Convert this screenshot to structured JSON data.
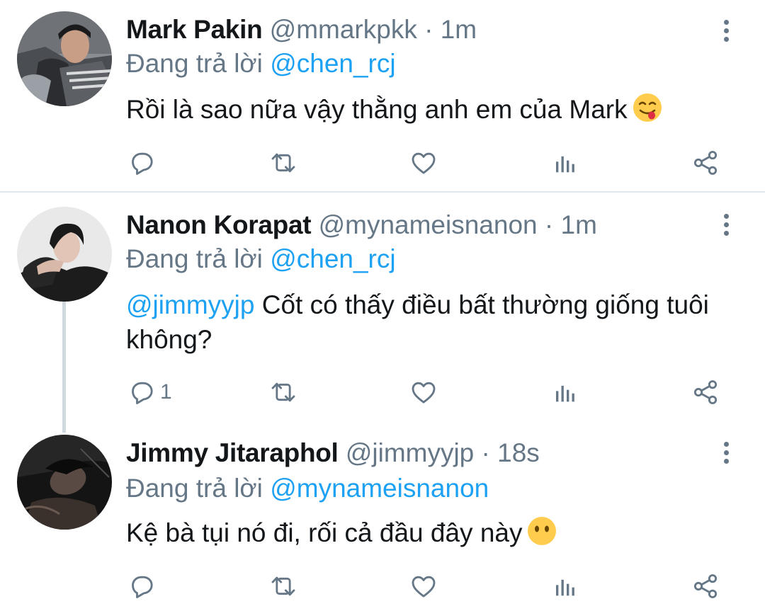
{
  "tweets": [
    {
      "name": "Mark Pakin",
      "handle": "@mmarkpkk",
      "separator": "·",
      "time": "1m",
      "reply_label": "Đang trả lời",
      "reply_to": "@chen_rcj",
      "mention": "",
      "text": "Rồi là sao nữa vậy thằng anh em của Mark",
      "emoji": "face-savoring-food-emoji",
      "reply_count": "",
      "icons": {
        "reply": "reply-icon",
        "retweet": "retweet-icon",
        "like": "heart-icon",
        "analytics": "analytics-icon",
        "share": "share-icon",
        "more": "more-vertical-icon"
      }
    },
    {
      "name": "Nanon Korapat",
      "handle": "@mynameisnanon",
      "separator": "·",
      "time": "1m",
      "reply_label": "Đang trả lời",
      "reply_to": "@chen_rcj",
      "mention": "@jimmyyjp",
      "text": "Cốt có thấy điều bất thường giống tuôi không?",
      "emoji": "",
      "reply_count": "1",
      "icons": {
        "reply": "reply-icon",
        "retweet": "retweet-icon",
        "like": "heart-icon",
        "analytics": "analytics-icon",
        "share": "share-icon",
        "more": "more-vertical-icon"
      }
    },
    {
      "name": "Jimmy Jitaraphol",
      "handle": "@jimmyyjp",
      "separator": "·",
      "time": "18s",
      "reply_label": "Đang trả lời",
      "reply_to": "@mynameisnanon",
      "mention": "",
      "text": "Kệ bà tụi nó đi, rối cả đầu đây này",
      "emoji": "face-without-mouth-emoji",
      "reply_count": "",
      "icons": {
        "reply": "reply-icon",
        "retweet": "retweet-icon",
        "like": "heart-icon",
        "analytics": "analytics-icon",
        "share": "share-icon",
        "more": "more-vertical-icon"
      }
    }
  ],
  "colors": {
    "link": "#1da1f2",
    "muted": "#657786",
    "text": "#14171a",
    "thread_line": "#cfd9de",
    "divider": "#e1e8ed"
  }
}
